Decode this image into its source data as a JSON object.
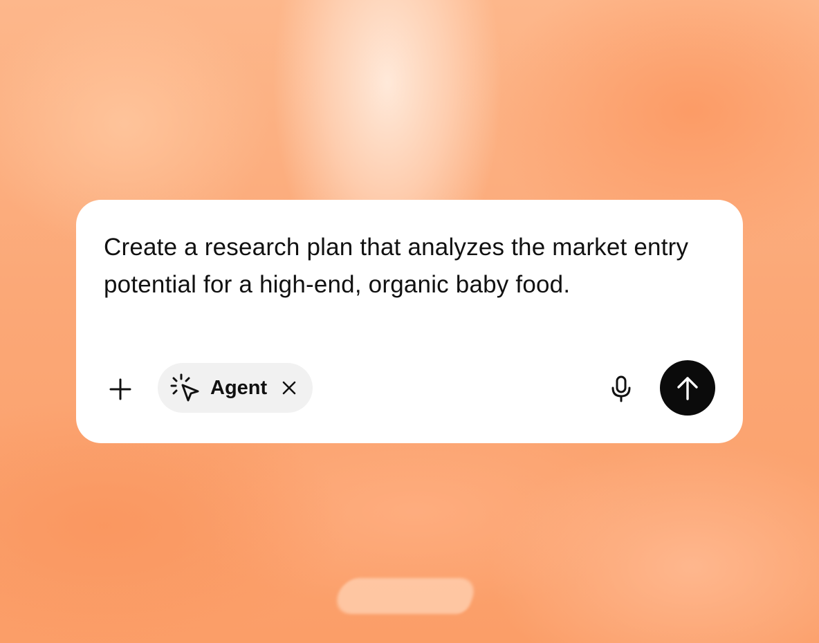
{
  "composer": {
    "prompt_text": "Create a research plan that analyzes the market entry potential for a high-end, organic baby food.",
    "add_icon": "plus-icon",
    "agent_chip": {
      "label": "Agent",
      "icon": "cursor-sparkle-icon",
      "remove_icon": "close-icon"
    },
    "mic_icon": "microphone-icon",
    "send_icon": "arrow-up-icon"
  },
  "colors": {
    "background_accent": "#fba572",
    "card": "#ffffff",
    "chip": "#f1f1f1",
    "send_button": "#0b0b0b",
    "text": "#111111"
  }
}
